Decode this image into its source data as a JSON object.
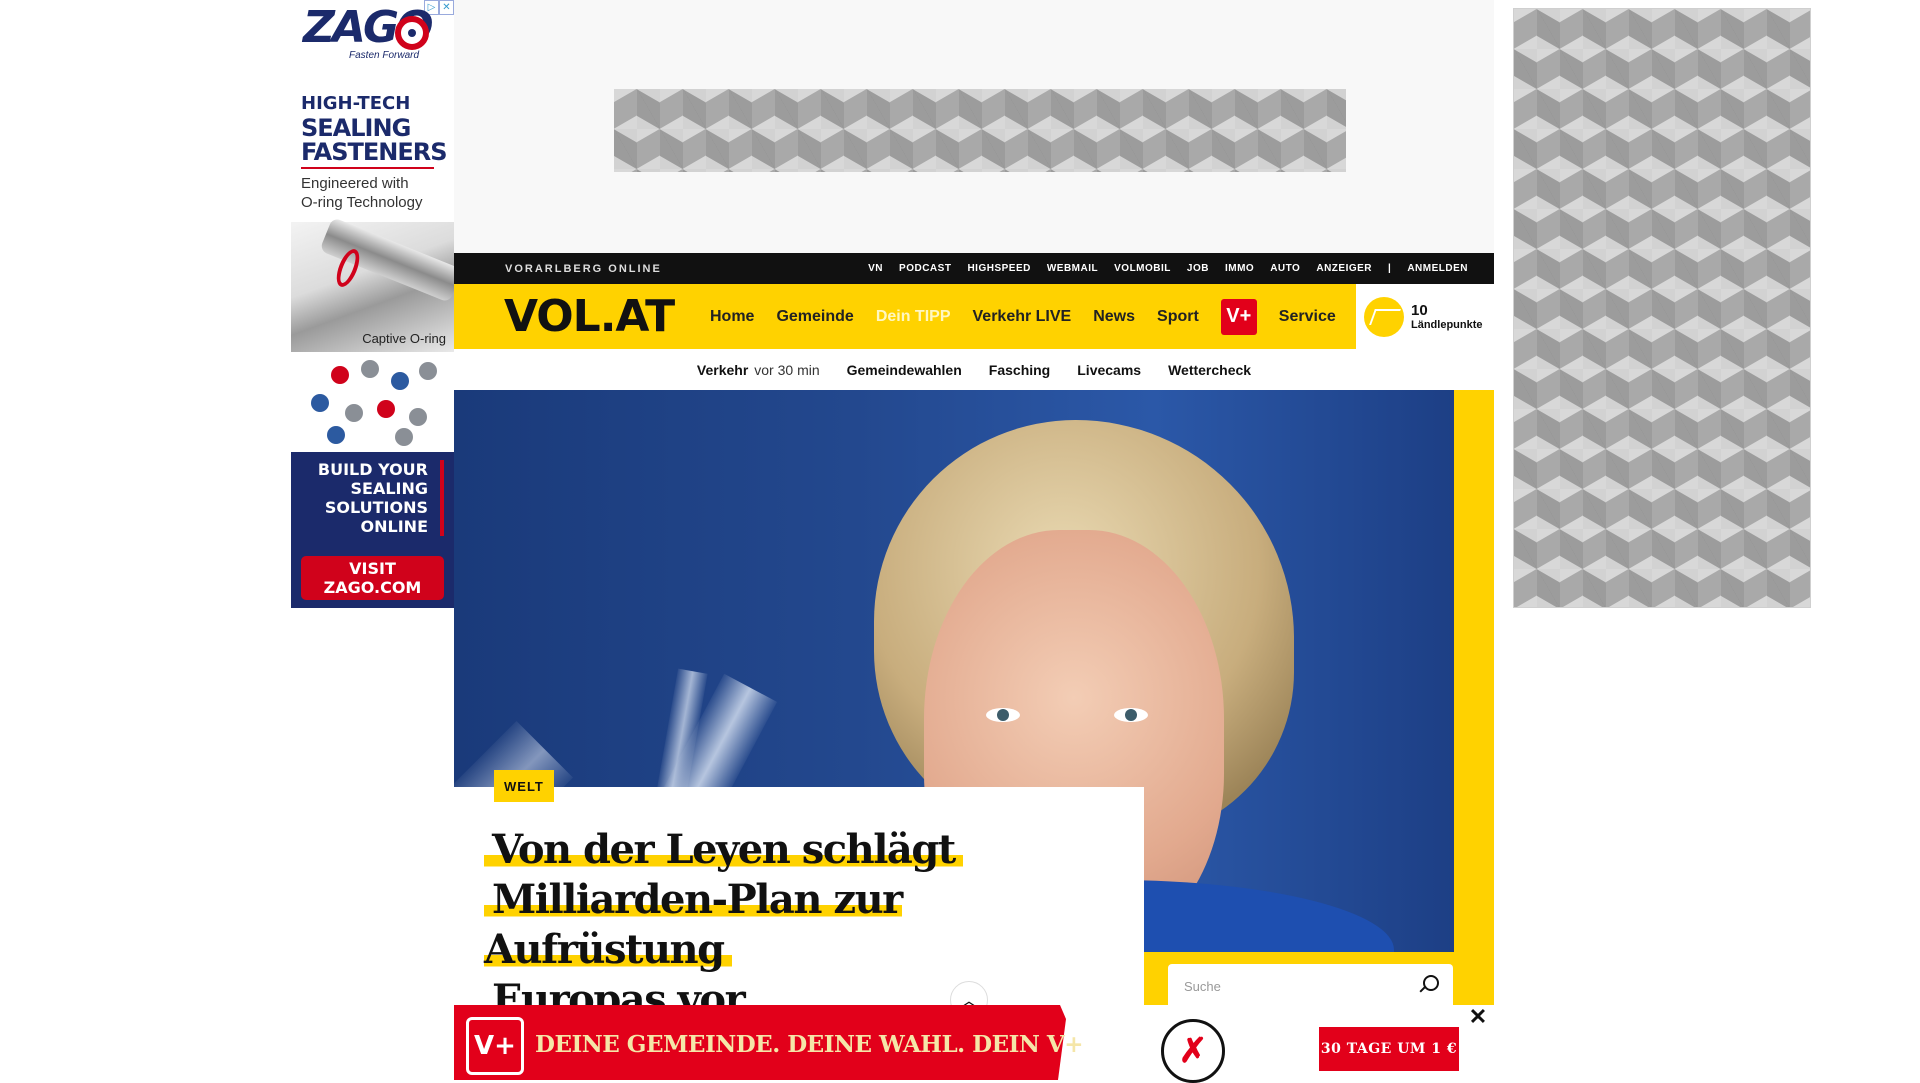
{
  "left_ad": {
    "controls": [
      "▷",
      "✕"
    ],
    "logo": "ZAGO",
    "tagline": "Fasten Forward",
    "headline_line1": "HIGH-TECH",
    "headline_line2": "SEALING",
    "headline_line3": "FASTENERS",
    "sub_line1": "Engineered with",
    "sub_line2": "O-ring Technology",
    "photo_caption": "Captive O-ring",
    "box_text": "BUILD YOUR SEALING SOLUTIONS ONLINE",
    "cta": "VISIT ZAGO.COM"
  },
  "topbar": {
    "brand": "VORARLBERG ONLINE",
    "links": [
      "VN",
      "PODCAST",
      "HIGHSPEED",
      "WEBMAIL",
      "VOLMOBIL",
      "JOB",
      "IMMO",
      "AUTO",
      "ANZEIGER",
      "|",
      "ANMELDEN"
    ]
  },
  "header": {
    "logo": "VOL.AT",
    "nav": {
      "home": "Home",
      "gemeinde": "Gemeinde",
      "tipp": "Dein TIPP",
      "verkehr": "Verkehr LIVE",
      "news": "News",
      "sport": "Sport",
      "vplus": "V+",
      "service": "Service"
    },
    "points_value": "10",
    "points_label": "Ländlepunkte"
  },
  "subnav": {
    "verkehr": "Verkehr",
    "verkehr_time": "vor 30 min",
    "gemeindewahlen": "Gemeindewahlen",
    "fasching": "Fasching",
    "livecams": "Livecams",
    "wettercheck": "Wettercheck"
  },
  "article": {
    "category": "WELT",
    "headline_line1": "Von der Leyen schlägt",
    "headline_line2": "Milliarden-Plan zur Aufrüstung",
    "headline_line3": "Europas vor"
  },
  "search": {
    "placeholder": "Suche"
  },
  "vplus_banner": {
    "logo": "V+",
    "text": "DEINE GEMEINDE. DEINE WAHL. DEIN V+",
    "cta": "30 TAGE UM 1 €",
    "close": "✕",
    "ballot": "✗"
  },
  "colors": {
    "brand_yellow": "#ffd200",
    "vplus_red": "#e2001a",
    "topbar_black": "#111111"
  },
  "icons": [
    "search-icon",
    "close-icon",
    "chevron-up-icon",
    "ballot-icon",
    "mountain-icon",
    "adchoices-icon"
  ]
}
